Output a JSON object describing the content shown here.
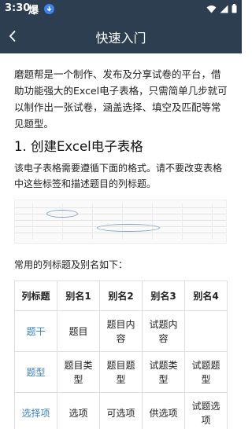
{
  "status_bar": {
    "time": "3:30",
    "app_icon_text": "爆"
  },
  "header": {
    "title": "快速入门"
  },
  "content": {
    "intro": "磨题帮是一个制作、发布及分享试卷的平台，借助功能强大的Excel电子表格，只需简单几步就可以制作出一张试卷，涵盖选择、填空及匹配等常见题型。",
    "section1_title": "1. 创建Excel电子表格",
    "section1_text": "该电子表格需要遵循下面的格式。请不要改变表格中这些标签和描述题目的列标题。",
    "list_title": "常用的列标题及别名如下：",
    "alias_table": {
      "headers": [
        "列标题",
        "别名1",
        "别名2",
        "别名3",
        "别名4"
      ],
      "rows": [
        [
          "题干",
          "题目",
          "题目内容",
          "试题内容",
          ""
        ],
        [
          "题型",
          "题目类型",
          "题目题型",
          "试题类型",
          "试题题型"
        ],
        [
          "选择项",
          "选项",
          "可选项",
          "供选项",
          "试题选项"
        ]
      ]
    }
  }
}
